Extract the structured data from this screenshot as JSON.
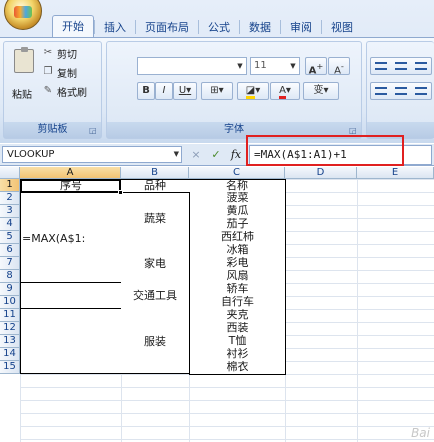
{
  "ribbon": {
    "tabs": [
      "开始",
      "插入",
      "页面布局",
      "公式",
      "数据",
      "审阅",
      "视图"
    ],
    "active_tab": "开始",
    "clipboard": {
      "paste_label": "粘贴",
      "cut_label": "剪切",
      "copy_label": "复制",
      "format_painter_label": "格式刷",
      "group_label": "剪贴板"
    },
    "font": {
      "font_size": "11",
      "grow_label": "A",
      "shrink_label": "A",
      "bold": "B",
      "italic": "I",
      "underline": "U",
      "group_label": "字体",
      "font_color_label": "A",
      "phonetic_label": "变"
    }
  },
  "formula_bar": {
    "name_box": "VLOOKUP",
    "cancel_icon": "×",
    "enter_icon": "✓",
    "fx_label": "fx",
    "formula": "=MAX(A$1:A1)+1"
  },
  "grid": {
    "columns": [
      "A",
      "B",
      "C",
      "D",
      "E"
    ],
    "rows": [
      "1",
      "2",
      "3",
      "4",
      "5",
      "6",
      "7",
      "8",
      "9",
      "10",
      "11",
      "12",
      "13",
      "14",
      "15"
    ],
    "header_row": {
      "a": "序号",
      "b": "品种",
      "c": "名称"
    },
    "a5_value": "=MAX(A$1:",
    "categories": [
      "蔬菜",
      "家电",
      "交通工具",
      "服装"
    ],
    "names": [
      "菠菜",
      "黄瓜",
      "茄子",
      "西红柿",
      "冰箱",
      "彩电",
      "风扇",
      "轿车",
      "自行车",
      "夹克",
      "西装",
      "T恤",
      "衬衫",
      "棉衣"
    ]
  },
  "watermark": "Bai"
}
